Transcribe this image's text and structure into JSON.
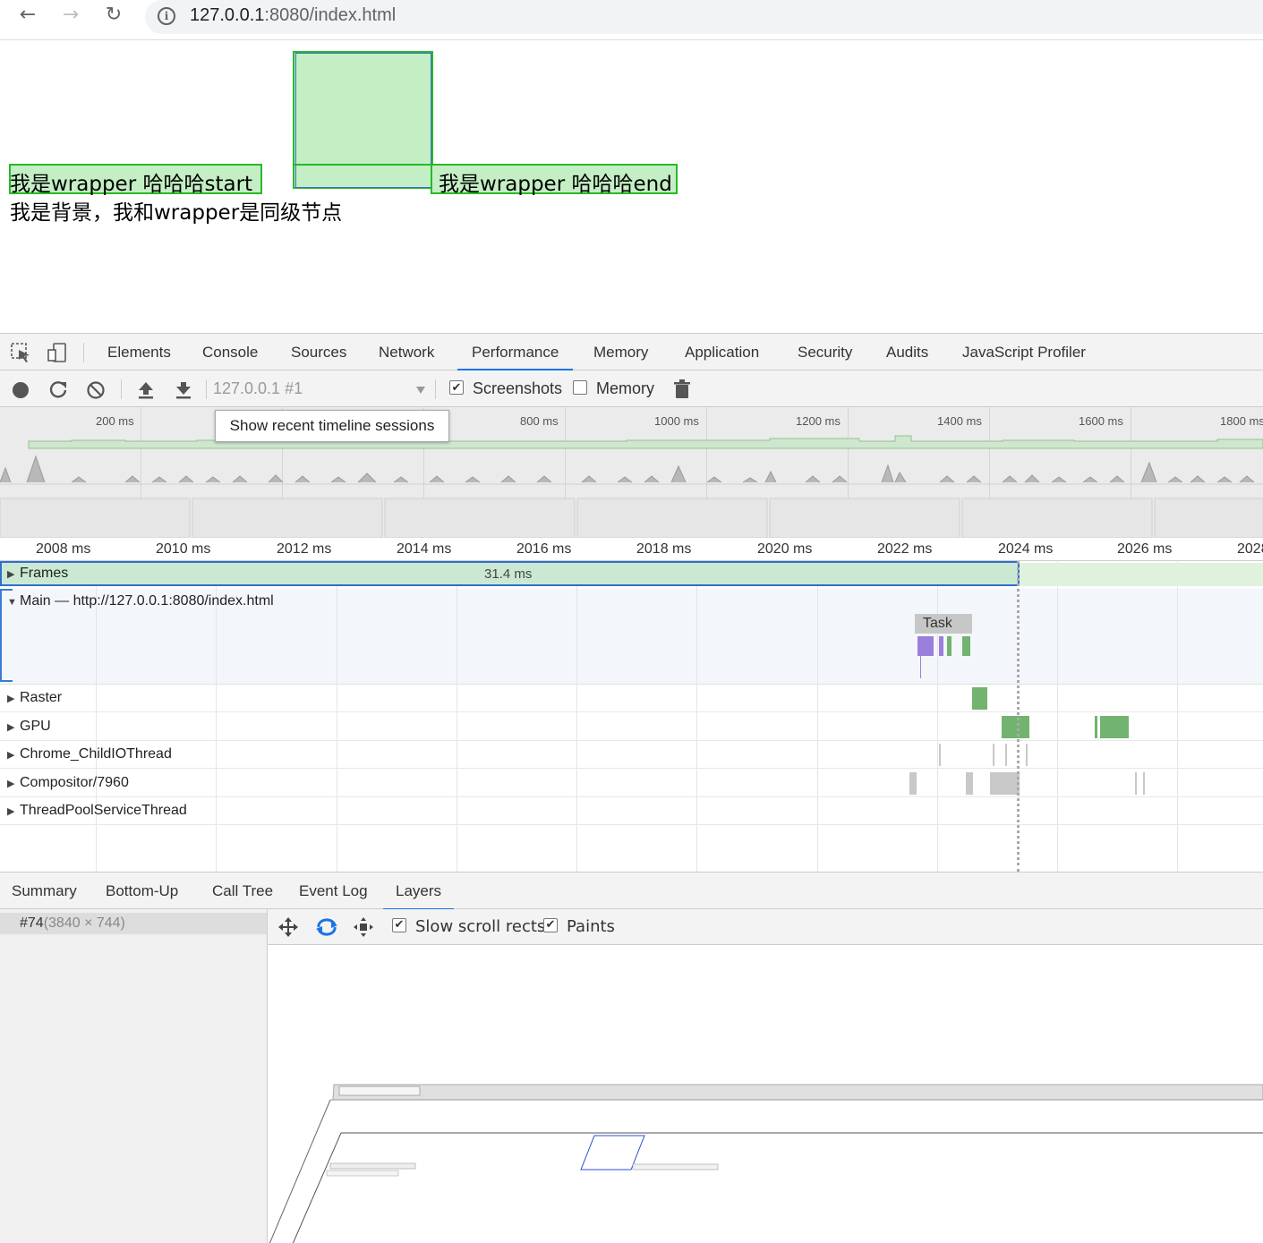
{
  "browser": {
    "url_host": "127.0.0.1",
    "url_rest": ":8080/index.html",
    "back_icon": "←",
    "forward_icon": "→",
    "reload_icon": "↻",
    "info_icon": "i"
  },
  "page": {
    "start_text": "我是wrapper 哈哈哈start",
    "end_text": "我是wrapper 哈哈哈end",
    "bg_text": "我是背景，我和wrapper是同级节点"
  },
  "devtools": {
    "tabs": [
      {
        "label": "Elements"
      },
      {
        "label": "Console"
      },
      {
        "label": "Sources"
      },
      {
        "label": "Network"
      },
      {
        "label": "Performance"
      },
      {
        "label": "Memory"
      },
      {
        "label": "Application"
      },
      {
        "label": "Security"
      },
      {
        "label": "Audits"
      },
      {
        "label": "JavaScript Profiler"
      }
    ],
    "toolbar": {
      "session": "127.0.0.1 #1",
      "screenshots_label": "Screenshots",
      "memory_label": "Memory",
      "screenshots_checked": "✔",
      "memory_checked": ""
    },
    "overview": {
      "ticks": [
        "200 ms",
        "800 ms",
        "1000 ms",
        "1200 ms",
        "1400 ms",
        "1600 ms",
        "1800 ms"
      ],
      "tooltip": "Show recent timeline sessions"
    },
    "timeline": {
      "ticks": [
        "2008 ms",
        "2010 ms",
        "2012 ms",
        "2014 ms",
        "2016 ms",
        "2018 ms",
        "2020 ms",
        "2022 ms",
        "2024 ms",
        "2026 ms",
        "2028"
      ],
      "frames_label": "Frames",
      "frame_duration": "31.4 ms",
      "main_label": "Main — http://127.0.0.1:8080/index.html",
      "task_label": "Task",
      "tracks": [
        "Raster",
        "GPU",
        "Chrome_ChildIOThread",
        "Compositor/7960",
        "ThreadPoolServiceThread"
      ]
    },
    "bottom_tabs": [
      {
        "label": "Summary"
      },
      {
        "label": "Bottom-Up"
      },
      {
        "label": "Call Tree"
      },
      {
        "label": "Event Log"
      },
      {
        "label": "Layers"
      }
    ],
    "layers": {
      "layer_id": "#74",
      "layer_size": "(3840 × 744)",
      "slow_scroll_label": "Slow scroll rects",
      "paints_label": "Paints",
      "checked": "✔"
    }
  }
}
